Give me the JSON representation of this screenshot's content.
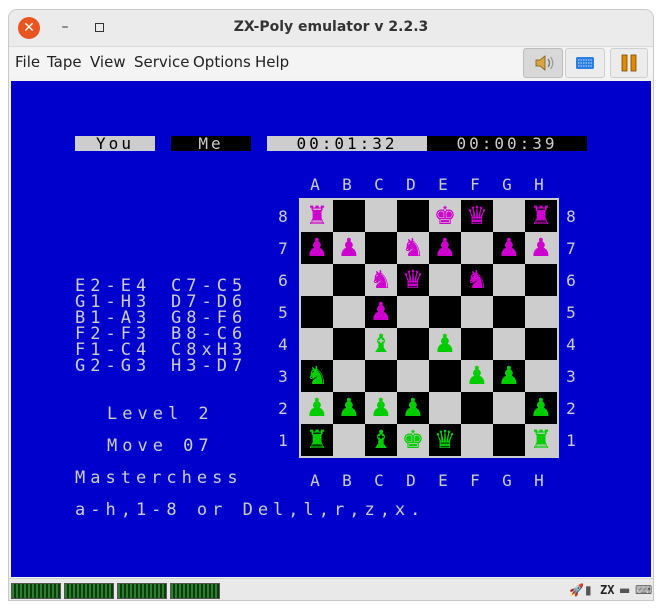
{
  "window": {
    "title": "ZX-Poly emulator v 2.2.3"
  },
  "menu": [
    "File",
    "Tape",
    "View",
    "Service",
    "Options",
    "Help"
  ],
  "toolbar": {
    "sound_icon": "speaker-icon",
    "keyboard_icon": "keyboard-icon",
    "pause_icon": "pause-icon"
  },
  "game": {
    "player_labels": [
      "You",
      "Me"
    ],
    "timers": [
      "00:01:32",
      "00:00:39"
    ],
    "files": [
      "A",
      "B",
      "C",
      "D",
      "E",
      "F",
      "G",
      "H"
    ],
    "ranks": [
      "8",
      "7",
      "6",
      "5",
      "4",
      "3",
      "2",
      "1"
    ],
    "moves": [
      [
        "E2-E4",
        "C7-C5"
      ],
      [
        "G1-H3",
        "D7-D6"
      ],
      [
        "B1-A3",
        "G8-F6"
      ],
      [
        "F2-F3",
        "B8-C6"
      ],
      [
        "F1-C4",
        "C8xH3"
      ],
      [
        "G2-G3",
        "H3-D7"
      ]
    ],
    "level": "Level 2",
    "move": "Move 07",
    "program": "Masterchess",
    "help": "a-h,1-8 or Del,l,r,z,x.",
    "board": [
      "r...kq.r",
      "pp.np.pp",
      "..nq.n..",
      "..p.....",
      "..B.P...",
      "N....PP.",
      "PPPP...P",
      "R.BKQ..R"
    ]
  },
  "colors": {
    "screen": "#0000cd",
    "light_square": "#cdcdcd",
    "dark_square": "#000000",
    "ink": "#cdcdcd",
    "black_pieces": "#cd00cd",
    "white_pieces": "#00cd00",
    "close": "#e95420"
  },
  "status": {
    "icons": [
      "rocket-icon",
      "tape-icon",
      "zx-icon",
      "disk-icon",
      "keyboard-icon"
    ]
  }
}
